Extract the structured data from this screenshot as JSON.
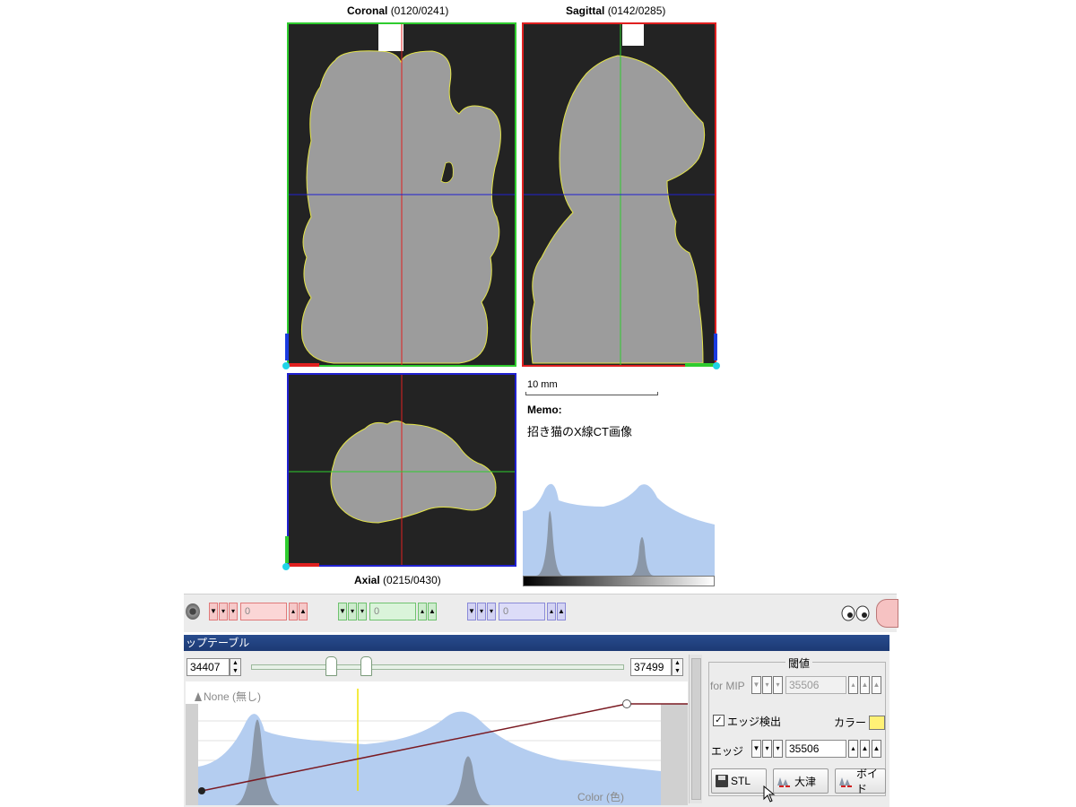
{
  "views": {
    "coronal": {
      "name": "Coronal",
      "index": "(0120/0241)"
    },
    "sagittal": {
      "name": "Sagittal",
      "index": "(0142/0285)"
    },
    "axial": {
      "name": "Axial",
      "index": "(0215/0430)"
    }
  },
  "scale_bar": {
    "label": "10 mm"
  },
  "memo": {
    "title": "Memo:",
    "text": "招き猫のX線CT画像"
  },
  "toolbar": {
    "red_value": "0",
    "green_value": "0",
    "blue_value": "0"
  },
  "lookup_panel": {
    "title": "ップテーブル",
    "range_min": "34407",
    "range_max": "37499",
    "none_label": "None (無し)",
    "color_label": "Color (色)"
  },
  "threshold": {
    "group_title": "閾値",
    "mip_label": "for MIP",
    "mip_value": "35506",
    "edge_checkbox_label": "エッジ検出",
    "edge_checked": true,
    "color_label": "カラー",
    "color_swatch": "#fff176",
    "edge_label": "エッジ",
    "edge_value": "35506",
    "stl_button": "STL",
    "otsu_button": "大津",
    "void_button": "ボイド"
  },
  "colors": {
    "coronal_border": "#2ecc2e",
    "sagittal_border": "#e02020",
    "axial_border": "#2020d0",
    "histogram_fill": "#b4cdf0",
    "histogram_peak": "#8a97a8",
    "panel_header": "#1f3f7c"
  }
}
